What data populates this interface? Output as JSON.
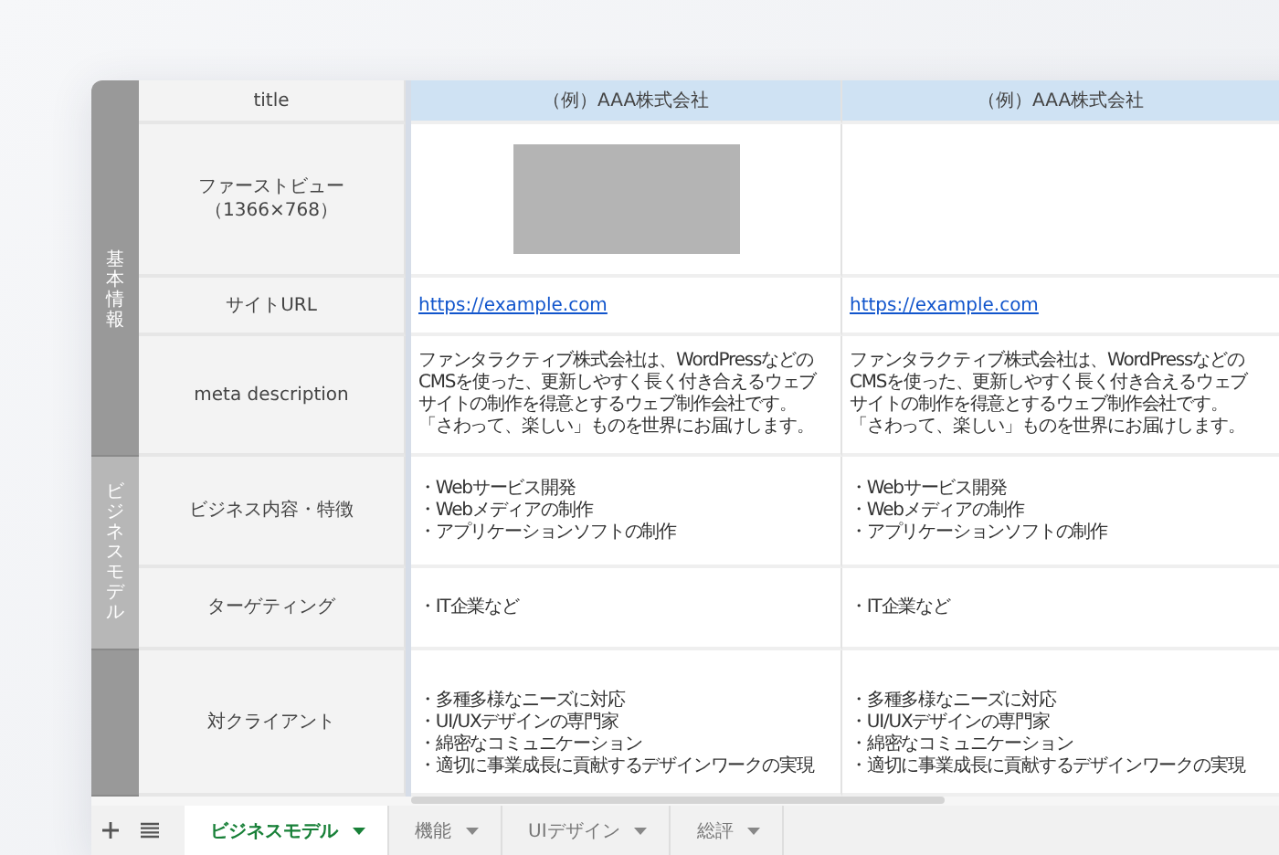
{
  "header": {
    "label": "title",
    "companies": [
      "（例）AAA株式会社",
      "（例）AAA株式会社"
    ]
  },
  "groups": [
    {
      "label": "基本情報",
      "color": "#999999",
      "rows": [
        {
          "label": "ファーストビュー",
          "sublabel": "（1366×768）",
          "cells": [
            {
              "kind": "image"
            },
            {
              "kind": "empty"
            }
          ]
        },
        {
          "label": "サイトURL",
          "cells": [
            {
              "kind": "link",
              "text": "https://example.com"
            },
            {
              "kind": "link",
              "text": "https://example.com"
            }
          ]
        },
        {
          "label": "meta description",
          "cells": [
            {
              "kind": "text",
              "text": "ファンタラクティブ株式会社は、WordPressなどのCMSを使った、更新しやすく長く付き合えるウェブサイトの制作を得意とするウェブ制作会社です。「さわって、楽しい」ものを世界にお届けします。"
            },
            {
              "kind": "text",
              "text": "ファンタラクティブ株式会社は、WordPressなどのCMSを使った、更新しやすく長く付き合えるウェブサイトの制作を得意とするウェブ制作会社です。「さわって、楽しい」ものを世界にお届けします。"
            }
          ]
        }
      ]
    },
    {
      "label": "ビジネスモデル",
      "color": "#b7b7b7",
      "rows": [
        {
          "label": "ビジネス内容・特徴",
          "cells": [
            {
              "kind": "list",
              "lines": [
                "・Webサービス開発",
                "・Webメディアの制作",
                "・アプリケーションソフトの制作"
              ]
            },
            {
              "kind": "list",
              "lines": [
                "・Webサービス開発",
                "・Webメディアの制作",
                "・アプリケーションソフトの制作"
              ]
            }
          ]
        },
        {
          "label": "ターゲティング",
          "cells": [
            {
              "kind": "list",
              "lines": [
                "・IT企業など"
              ]
            },
            {
              "kind": "list",
              "lines": [
                "・IT企業など"
              ]
            }
          ]
        }
      ]
    },
    {
      "color": "#999999",
      "rows": [
        {
          "label": "対クライアント",
          "cells": [
            {
              "kind": "list",
              "lines": [
                "・多種多様なニーズに対応",
                "・UI/UXデザインの専門家",
                "・綿密なコミュニケーション",
                "・適切に事業成長に貢献するデザインワークの実現"
              ]
            },
            {
              "kind": "list",
              "lines": [
                "・多種多様なニーズに対応",
                "・UI/UXデザインの専門家",
                "・綿密なコミュニケーション",
                "・適切に事業成長に貢献するデザインワークの実現"
              ]
            }
          ]
        }
      ]
    }
  ],
  "sheet_tabs": [
    {
      "label": "ビジネスモデル",
      "selected": true
    },
    {
      "label": "機能",
      "selected": false
    },
    {
      "label": "UIデザイン",
      "selected": false
    },
    {
      "label": "総評",
      "selected": false
    }
  ]
}
